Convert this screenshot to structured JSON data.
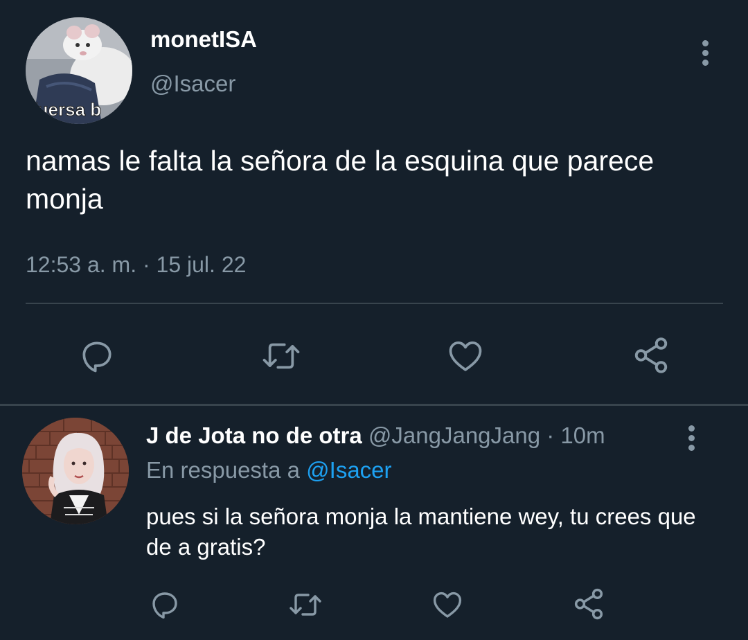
{
  "main_tweet": {
    "display_name": "monetISA",
    "handle": "@Isacer",
    "text": "namas le falta la señora de la esquina que parece monja",
    "timestamp": "12:53 a. m. · 15 jul. 22",
    "avatar_caption": "fuersa b"
  },
  "reply": {
    "display_name": "J de Jota no de otra",
    "meta": " @JangJangJang · 10m",
    "reply_prefix": "En respuesta a ",
    "reply_mention": "@Isacer",
    "text": "pues si la señora monja la mantiene wey, tu crees que de a gratis?"
  },
  "icons": {
    "reply": "reply-icon",
    "retweet": "retweet-icon",
    "like": "heart-icon",
    "share": "share-icon",
    "more": "more-vertical-icon"
  },
  "colors": {
    "background": "#15202b",
    "divider": "#38444d",
    "secondary_text": "#8899a6",
    "link": "#1da1f2"
  }
}
